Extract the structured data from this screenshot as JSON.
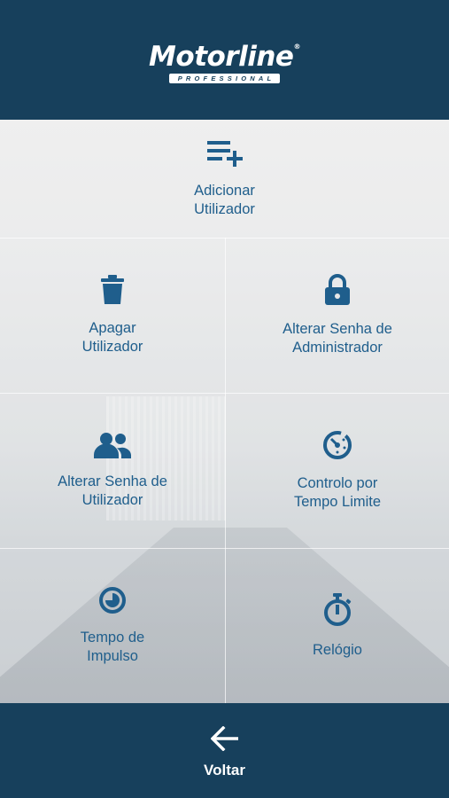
{
  "header": {
    "logo_text": "Motorline",
    "logo_reg": "®",
    "logo_subtext": "PROFESSIONAL"
  },
  "menu": {
    "add_user": {
      "label": "Adicionar\nUtilizador",
      "icon": "add-list-icon"
    },
    "delete_user": {
      "label": "Apagar\nUtilizador",
      "icon": "trash-icon"
    },
    "change_admin_password": {
      "label": "Alterar Senha de\nAdministrador",
      "icon": "lock-icon"
    },
    "change_user_password": {
      "label": "Alterar Senha de\nUtilizador",
      "icon": "users-icon"
    },
    "time_limit_control": {
      "label": "Controlo por\nTempo Limite",
      "icon": "timer-dial-icon"
    },
    "pulse_time": {
      "label": "Tempo de\nImpulso",
      "icon": "clock-half-icon"
    },
    "clock": {
      "label": "Relógio",
      "icon": "stopwatch-icon"
    }
  },
  "footer": {
    "back_label": "Voltar",
    "icon": "arrow-left-icon"
  },
  "colors": {
    "brand": "#17405c",
    "accent": "#1f5e8c",
    "text_on_brand": "#ffffff"
  }
}
